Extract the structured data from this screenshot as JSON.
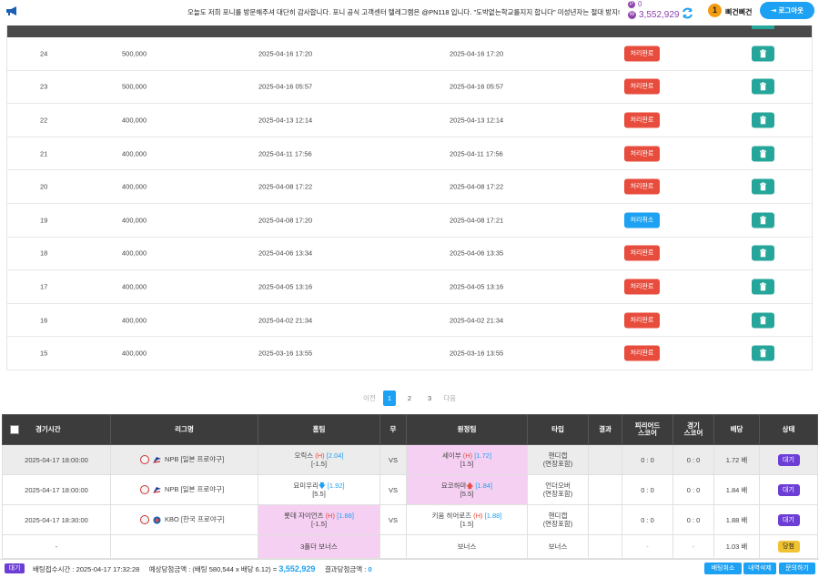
{
  "header": {
    "notice": "오늘도 저희 포니를 방문해주셔 대단히 감사합니다. 포니 공식 고객센터 텔레그램은 @PN118 입니다. \"도박없는학교를지지 합니다\" 미성년자는 절대 방지!",
    "points": "0",
    "balance": "3,552,929",
    "level": "1",
    "username": "삐건삐건",
    "logout_label": "로그아웃"
  },
  "history": {
    "rows": [
      {
        "no": "24",
        "amount": "500,000",
        "date1": "2025-04-16 17:20",
        "date2": "2025-04-16 17:20",
        "status": "처리완료",
        "kind": "done"
      },
      {
        "no": "23",
        "amount": "500,000",
        "date1": "2025-04-16 05:57",
        "date2": "2025-04-16 05:57",
        "status": "처리완료",
        "kind": "done"
      },
      {
        "no": "22",
        "amount": "400,000",
        "date1": "2025-04-13 12:14",
        "date2": "2025-04-13 12:14",
        "status": "처리완료",
        "kind": "done"
      },
      {
        "no": "21",
        "amount": "400,000",
        "date1": "2025-04-11 17:56",
        "date2": "2025-04-11 17:56",
        "status": "처리완료",
        "kind": "done"
      },
      {
        "no": "20",
        "amount": "400,000",
        "date1": "2025-04-08 17:22",
        "date2": "2025-04-08 17:22",
        "status": "처리완료",
        "kind": "done"
      },
      {
        "no": "19",
        "amount": "400,000",
        "date1": "2025-04-08 17:20",
        "date2": "2025-04-08 17:21",
        "status": "처리취소",
        "kind": "cancel"
      },
      {
        "no": "18",
        "amount": "400,000",
        "date1": "2025-04-06 13:34",
        "date2": "2025-04-06 13:35",
        "status": "처리완료",
        "kind": "done"
      },
      {
        "no": "17",
        "amount": "400,000",
        "date1": "2025-04-05 13:16",
        "date2": "2025-04-05 13:16",
        "status": "처리완료",
        "kind": "done"
      },
      {
        "no": "16",
        "amount": "400,000",
        "date1": "2025-04-02 21:34",
        "date2": "2025-04-02 21:34",
        "status": "처리완료",
        "kind": "done"
      },
      {
        "no": "15",
        "amount": "400,000",
        "date1": "2025-03-16 13:55",
        "date2": "2025-03-16 13:55",
        "status": "처리완료",
        "kind": "done"
      }
    ]
  },
  "pager": {
    "prev": "이전",
    "pages": [
      "1",
      "2",
      "3"
    ],
    "current": "1",
    "next": "다음"
  },
  "bets": {
    "headers": {
      "time": "경기시간",
      "league": "리그명",
      "home": "홈팀",
      "draw": "무",
      "away": "원정팀",
      "type": "타입",
      "result": "결과",
      "period_l1": "피리어드",
      "period_l2": "스코어",
      "score_l1": "경기",
      "score_l2": "스코어",
      "odds": "배당",
      "status": "상태"
    },
    "rows": [
      {
        "time": "2025-04-17 18:00:00",
        "league": "NPB [일본 프로야구]",
        "home_name": "오릭스",
        "home_tag": "(H)",
        "home_arrow": "",
        "home_odds": "[2.04]",
        "home_line": "[-1.5]",
        "draw": "VS",
        "away_name": "세이부",
        "away_tag": "(H)",
        "away_arrow": "",
        "away_odds": "[1.72]",
        "away_line": "[1.5]",
        "type_l1": "핸디캡",
        "type_l2": "(연장포함)",
        "result": "",
        "period": "0 : 0",
        "score": "0 : 0",
        "odds": "1.72 배",
        "status": "대기"
      },
      {
        "time": "2025-04-17 18:00:00",
        "league": "NPB [일본 프로야구]",
        "home_name": "요미우리",
        "home_tag": "",
        "home_arrow": "🡇",
        "home_odds": "[1.92]",
        "home_line": "[5.5]",
        "draw": "VS",
        "away_name": "요코하마",
        "away_tag": "",
        "away_arrow": "🡅",
        "away_odds": "[1.84]",
        "away_line": "[5.5]",
        "type_l1": "언더오버",
        "type_l2": "(연장포함)",
        "result": "",
        "period": "0 : 0",
        "score": "0 : 0",
        "odds": "1.84 배",
        "status": "대기"
      },
      {
        "time": "2025-04-17 18:30:00",
        "league": "KBO [한국 프로야구]",
        "home_name": "롯데 자이언츠",
        "home_tag": "(H)",
        "home_arrow": "",
        "home_odds": "[1.88]",
        "home_line": "[-1.5]",
        "draw": "VS",
        "away_name": "키움 히어로즈",
        "away_tag": "(H)",
        "away_arrow": "",
        "away_odds": "[1.88]",
        "away_line": "[1.5]",
        "type_l1": "핸디캡",
        "type_l2": "(연장포함)",
        "result": "",
        "period": "0 : 0",
        "score": "0 : 0",
        "odds": "1.88 배",
        "status": "대기"
      },
      {
        "time": "-",
        "league": "",
        "home_name": "3폴더 보너스",
        "draw": "",
        "away_name": "보너스",
        "type_l1": "보너스",
        "result": "",
        "period": "-",
        "score": "-",
        "odds": "1.03 배",
        "status": "당첨"
      }
    ]
  },
  "footer": {
    "wait_label": "대기",
    "bet_time": "배팅접수시간 : 2025-04-17 17:32:28",
    "expected_prefix": "예상당첨금액 : (배팅 580,544 x 배당 6.12) = ",
    "expected_value": "3,552,929",
    "result_prefix": "결과당첨금액 : ",
    "result_value": "0",
    "btn_cancel": "배팅취소",
    "btn_delete": "내역삭제",
    "btn_inquiry": "문의하기"
  },
  "colors": {
    "accent": "#1da1f2",
    "done": "#e74c3c",
    "delete": "#26a69a",
    "wait": "#6c3ed6",
    "win": "#f1c232",
    "pink": "#f5d0f2"
  }
}
